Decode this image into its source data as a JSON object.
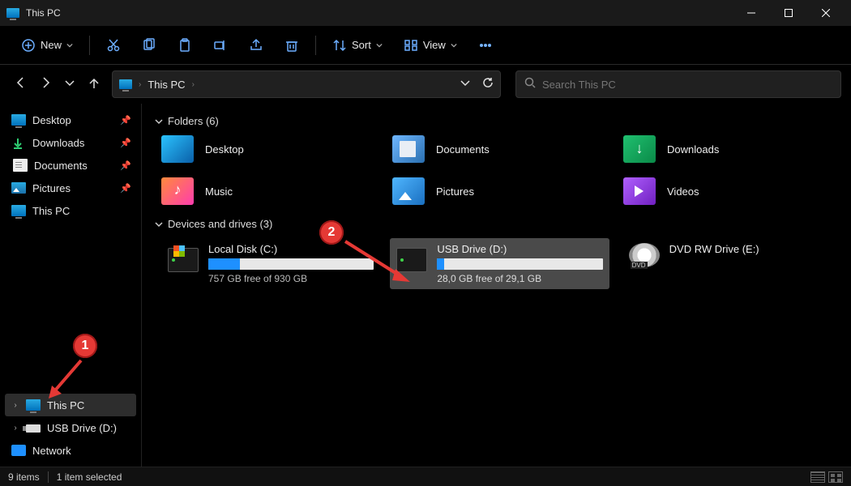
{
  "window": {
    "title": "This PC"
  },
  "toolbar": {
    "new_label": "New",
    "sort_label": "Sort",
    "view_label": "View"
  },
  "breadcrumb": {
    "root": "This PC"
  },
  "search": {
    "placeholder": "Search This PC"
  },
  "sidebar": {
    "quick": [
      {
        "label": "Desktop",
        "pinned": true,
        "icon": "monitor"
      },
      {
        "label": "Downloads",
        "pinned": true,
        "icon": "dl"
      },
      {
        "label": "Documents",
        "pinned": true,
        "icon": "doc"
      },
      {
        "label": "Pictures",
        "pinned": true,
        "icon": "pic"
      },
      {
        "label": "This PC",
        "pinned": false,
        "icon": "monitor"
      }
    ],
    "tree": [
      {
        "label": "This PC",
        "icon": "monitor",
        "selected": true
      },
      {
        "label": "USB Drive (D:)",
        "icon": "usb",
        "selected": false
      },
      {
        "label": "Network",
        "icon": "net",
        "selected": false
      }
    ]
  },
  "sections": {
    "folders_header": "Folders (6)",
    "drives_header": "Devices and drives (3)"
  },
  "folders": [
    {
      "label": "Desktop",
      "icon": "desktop"
    },
    {
      "label": "Documents",
      "icon": "documents"
    },
    {
      "label": "Downloads",
      "icon": "downloads"
    },
    {
      "label": "Music",
      "icon": "music"
    },
    {
      "label": "Pictures",
      "icon": "pictures"
    },
    {
      "label": "Videos",
      "icon": "videos"
    }
  ],
  "drives": [
    {
      "name": "Local Disk (C:)",
      "free_text": "757 GB free of 930 GB",
      "fill_pct": 19,
      "type": "hdd-win",
      "selected": false
    },
    {
      "name": "USB Drive (D:)",
      "free_text": "28,0 GB free of 29,1 GB",
      "fill_pct": 4,
      "type": "hdd",
      "selected": true
    },
    {
      "name": "DVD RW Drive (E:)",
      "free_text": "",
      "fill_pct": null,
      "type": "dvd",
      "selected": false
    }
  ],
  "status": {
    "items": "9 items",
    "selected": "1 item selected"
  },
  "annotations": {
    "marker1": "1",
    "marker2": "2"
  }
}
